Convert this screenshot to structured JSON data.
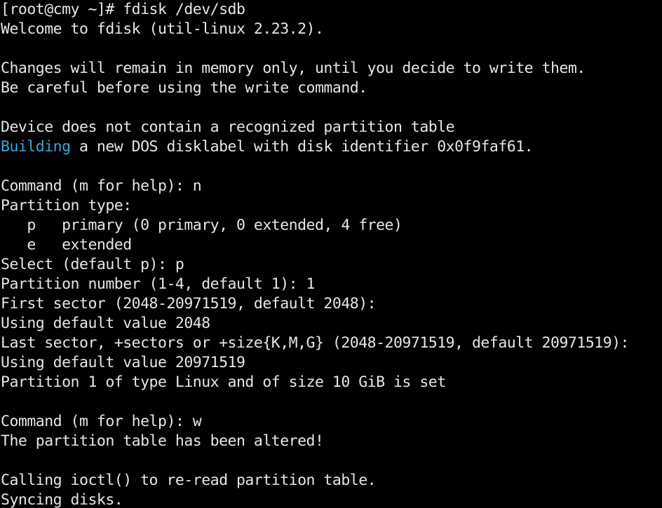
{
  "terminal": {
    "colors": {
      "background": "#000000",
      "foreground": "#e6e6e6",
      "highlight": "#3aa6d9"
    },
    "lines": [
      {
        "text": "[root@cmy ~]# fdisk /dev/sdb"
      },
      {
        "text": "Welcome to fdisk (util-linux 2.23.2)."
      },
      {
        "text": ""
      },
      {
        "text": "Changes will remain in memory only, until you decide to write them."
      },
      {
        "text": "Be careful before using the write command."
      },
      {
        "text": ""
      },
      {
        "text": "Device does not contain a recognized partition table"
      },
      {
        "highlight": "Building",
        "text": " a new DOS disklabel with disk identifier 0x0f9faf61."
      },
      {
        "text": ""
      },
      {
        "text": "Command (m for help): n"
      },
      {
        "text": "Partition type:"
      },
      {
        "text": "   p   primary (0 primary, 0 extended, 4 free)"
      },
      {
        "text": "   e   extended"
      },
      {
        "text": "Select (default p): p"
      },
      {
        "text": "Partition number (1-4, default 1): 1"
      },
      {
        "text": "First sector (2048-20971519, default 2048):"
      },
      {
        "text": "Using default value 2048"
      },
      {
        "text": "Last sector, +sectors or +size{K,M,G} (2048-20971519, default 20971519):"
      },
      {
        "text": "Using default value 20971519"
      },
      {
        "text": "Partition 1 of type Linux and of size 10 GiB is set"
      },
      {
        "text": ""
      },
      {
        "text": "Command (m for help): w"
      },
      {
        "text": "The partition table has been altered!"
      },
      {
        "text": ""
      },
      {
        "text": "Calling ioctl() to re-read partition table."
      },
      {
        "text": "Syncing disks."
      }
    ]
  }
}
